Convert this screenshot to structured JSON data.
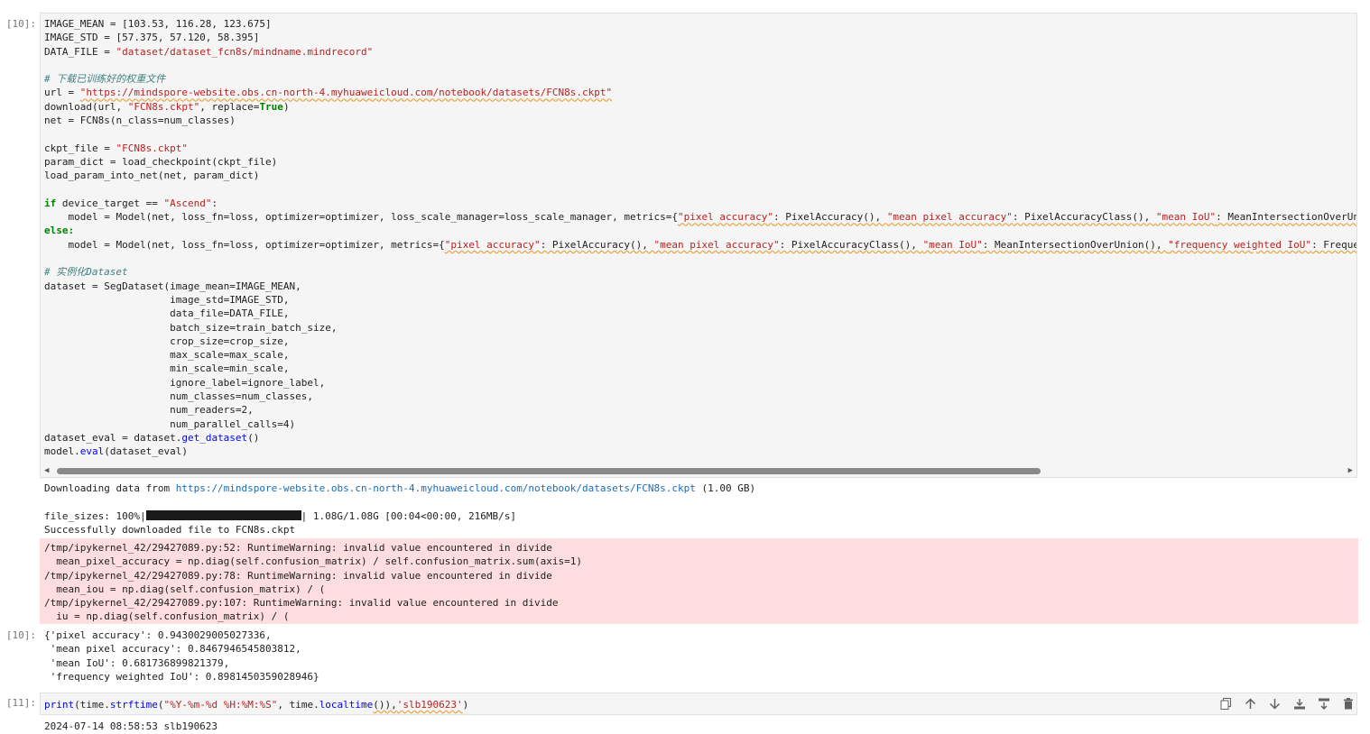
{
  "cells": {
    "c10": {
      "prompt": "[10]:",
      "code": {
        "l1": "IMAGE_MEAN = [103.53, 116.28, 123.675]",
        "l2": "IMAGE_STD = [57.375, 57.120, 58.395]",
        "l3a": "DATA_FILE = ",
        "l3b": "\"dataset/dataset_fcn8s/mindname.mindrecord\"",
        "l5": "# 下载已训练好的权重文件",
        "l6a": "url = ",
        "l6b": "\"https://mindspore-website.obs.cn-north-4.myhuaweicloud.com/notebook/datasets/FCN8s.ckpt\"",
        "l7a": "download(url, ",
        "l7b": "\"FCN8s.ckpt\"",
        "l7c": ", replace=",
        "l7d": "True",
        "l7e": ")",
        "l8": "net = FCN8s(n_class=num_classes)",
        "l10a": "ckpt_file = ",
        "l10b": "\"FCN8s.ckpt\"",
        "l11": "param_dict = load_checkpoint(ckpt_file)",
        "l12": "load_param_into_net(net, param_dict)",
        "l14a": "if",
        "l14b": " device_target == ",
        "l14c": "\"Ascend\"",
        "l14d": ":",
        "l15a": "    model = Model(net, loss_fn=loss, optimizer=optimizer, loss_scale_manager=loss_scale_manager, metrics={",
        "l15b": "\"pixel accuracy\"",
        "l15c": ": PixelAccuracy(), ",
        "l15d": "\"mean pixel accuracy\"",
        "l15e": ": PixelAccuracyClass(), ",
        "l15f": "\"mean IoU\"",
        "l15g": ": MeanIntersectionOverUnion(),",
        "l16": "else:",
        "l17a": "    model = Model(net, loss_fn=loss, optimizer=optimizer, metrics={",
        "l17b": "\"pixel accuracy\"",
        "l17c": ": PixelAccuracy(), ",
        "l17d": "\"mean pixel accuracy\"",
        "l17e": ": PixelAccuracyClass(), ",
        "l17f": "\"mean IoU\"",
        "l17g": ": MeanIntersectionOverUnion(), ",
        "l17h": "\"frequency weighted IoU\"",
        "l17i": ": FrequencyWei",
        "l19": "# 实例化Dataset",
        "l20": "dataset = SegDataset(image_mean=IMAGE_MEAN,",
        "l21": "                     image_std=IMAGE_STD,",
        "l22": "                     data_file=DATA_FILE,",
        "l23": "                     batch_size=train_batch_size,",
        "l24": "                     crop_size=crop_size,",
        "l25": "                     max_scale=max_scale,",
        "l26": "                     min_scale=min_scale,",
        "l27": "                     ignore_label=ignore_label,",
        "l28": "                     num_classes=num_classes,",
        "l29": "                     num_readers=2,",
        "l30": "                     num_parallel_calls=4)",
        "l31a": "dataset_eval = dataset.",
        "l31b": "get_dataset",
        "l31c": "()",
        "l32a": "model.",
        "l32b": "eval",
        "l32c": "(dataset_eval)"
      },
      "stdout": {
        "dl_prefix": "Downloading data from ",
        "dl_url": "https://mindspore-website.obs.cn-north-4.myhuaweicloud.com/notebook/datasets/FCN8s.ckpt",
        "dl_suffix": " (1.00 GB)",
        "prog_prefix": "file_sizes: 100%|",
        "prog_suffix": "| 1.08G/1.08G [00:04<00:00, 216MB/s]",
        "progress_fraction": 1.0,
        "success": "Successfully downloaded file to FCN8s.ckpt"
      },
      "stderr": [
        "/tmp/ipykernel_42/29427089.py:52: RuntimeWarning: invalid value encountered in divide",
        "  mean_pixel_accuracy = np.diag(self.confusion_matrix) / self.confusion_matrix.sum(axis=1)",
        "/tmp/ipykernel_42/29427089.py:78: RuntimeWarning: invalid value encountered in divide",
        "  mean_iou = np.diag(self.confusion_matrix) / (",
        "/tmp/ipykernel_42/29427089.py:107: RuntimeWarning: invalid value encountered in divide",
        "  iu = np.diag(self.confusion_matrix) / ("
      ],
      "result_prompt": "[10]:",
      "result": [
        "{'pixel accuracy': 0.9430029005027336,",
        " 'mean pixel accuracy': 0.8467946545803812,",
        " 'mean IoU': 0.681736899821379,",
        " 'frequency weighted IoU': 0.8981450359028946}"
      ]
    },
    "c11": {
      "prompt": "[11]:",
      "code": {
        "a": "print",
        "b": "(time.",
        "c": "strftime",
        "d": "(",
        "e": "\"%Y-%m-%d %H:%M:%S\"",
        "f": ", time.",
        "g": "localtime",
        "h": "()),",
        "i": "'slb190623'",
        "j": ")"
      },
      "output": "2024-07-14 08:58:53 slb190623"
    }
  },
  "toolbar": {
    "icons": [
      "duplicate-icon",
      "arrow-up-icon",
      "arrow-down-icon",
      "insert-above-icon",
      "insert-below-icon",
      "delete-icon"
    ]
  }
}
